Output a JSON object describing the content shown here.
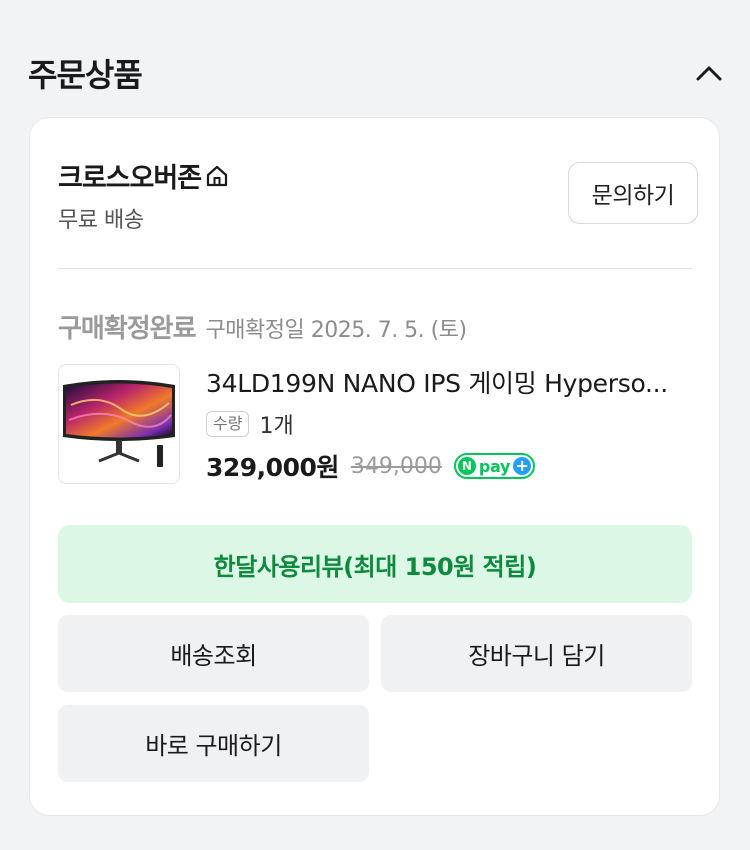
{
  "section": {
    "title": "주문상품"
  },
  "seller": {
    "name": "크로스오버존",
    "shipping": "무료 배송",
    "inquiry_label": "문의하기"
  },
  "order": {
    "status": "구매확정완료",
    "confirm_date": "구매확정일 2025. 7. 5. (토)"
  },
  "product": {
    "name": "34LD199N NANO IPS 게이밍 Hyperso...",
    "qty_label": "수량",
    "qty_value": "1개",
    "price": "329,000원",
    "original_price": "349,000",
    "npay": {
      "n": "N",
      "text": "pay",
      "plus": "+"
    }
  },
  "actions": {
    "review": "한달사용리뷰(최대 150원 적립)",
    "track": "배송조회",
    "cart": "장바구니 담기",
    "buy_now": "바로 구매하기"
  },
  "colors": {
    "review_bg": "#dcf7e5",
    "review_text": "#0d8a3e",
    "npay_green": "#03c75a",
    "npay_blue": "#21a1f5"
  }
}
